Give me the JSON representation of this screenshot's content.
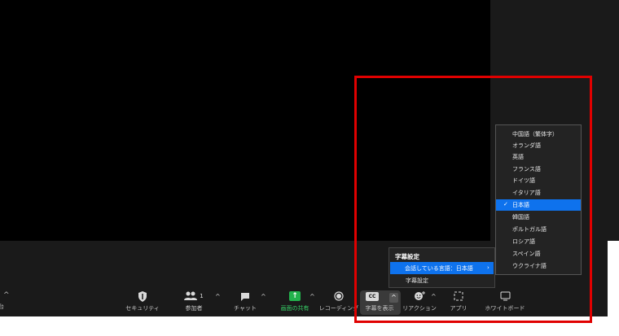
{
  "colors": {
    "accent": "#0e72ed",
    "share_green": "#22b14c",
    "highlight_frame": "#e00000"
  },
  "toolbar": {
    "left_clipped_label": "台",
    "items": [
      {
        "id": "security",
        "label": "セキュリティ",
        "icon": "shield-icon"
      },
      {
        "id": "participants",
        "label": "参加者",
        "icon": "people-icon",
        "count": "1"
      },
      {
        "id": "chat",
        "label": "チャット",
        "icon": "chat-bubble-icon"
      },
      {
        "id": "share",
        "label": "画面の共有",
        "icon": "share-screen-icon"
      },
      {
        "id": "record",
        "label": "レコーディング",
        "icon": "record-icon"
      },
      {
        "id": "captions",
        "label": "字幕を表示",
        "icon": "cc-icon",
        "icon_text": "CC"
      },
      {
        "id": "reactions",
        "label": "リアクション",
        "icon": "smiley-add-icon"
      },
      {
        "id": "apps",
        "label": "アプリ",
        "icon": "apps-icon"
      },
      {
        "id": "whiteboard",
        "label": "ホワイトボード",
        "icon": "whiteboard-icon"
      }
    ]
  },
  "caption_menu": {
    "title": "字幕設定",
    "items": [
      {
        "label": "会話している言語：日本語",
        "arrow": "›",
        "highlighted": true
      },
      {
        "label": "字幕設定",
        "highlighted": false
      }
    ]
  },
  "language_menu": {
    "items": [
      {
        "label": "中国語（繁体字）",
        "selected": false
      },
      {
        "label": "オランダ語",
        "selected": false
      },
      {
        "label": "英語",
        "selected": false
      },
      {
        "label": "フランス語",
        "selected": false
      },
      {
        "label": "ドイツ語",
        "selected": false
      },
      {
        "label": "イタリア語",
        "selected": false
      },
      {
        "label": "日本語",
        "selected": true,
        "check": "✓"
      },
      {
        "label": "韓国語",
        "selected": false
      },
      {
        "label": "ポルトガル語",
        "selected": false
      },
      {
        "label": "ロシア語",
        "selected": false
      },
      {
        "label": "スペイン語",
        "selected": false
      },
      {
        "label": "ウクライナ語",
        "selected": false
      }
    ]
  }
}
